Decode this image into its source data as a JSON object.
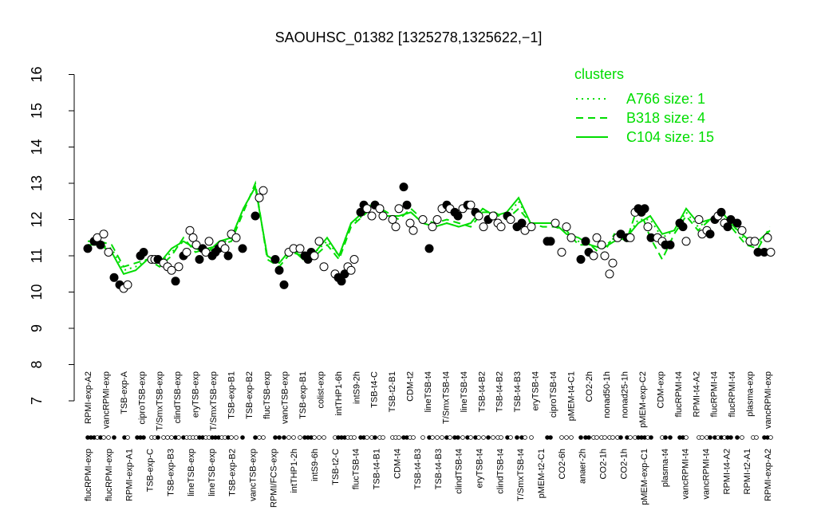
{
  "chart_data": {
    "type": "line",
    "title": "SAOUHSC_01382 [1325278,1325622,−1]",
    "xlabel": "",
    "ylabel": "",
    "ylim": [
      7,
      16
    ],
    "yticks": [
      7,
      8,
      9,
      10,
      11,
      12,
      13,
      14,
      15,
      16
    ],
    "grid": false,
    "legend": {
      "title": "clusters",
      "position": "top-right",
      "color": "#00dd00",
      "entries": [
        {
          "label": "A766 size: 1",
          "style": "dotted"
        },
        {
          "label": "B318 size: 4",
          "style": "dashed"
        },
        {
          "label": "C104 size: 15",
          "style": "solid"
        }
      ]
    },
    "conditions_top": [
      "RPMI-exp-A2",
      "vancRPMI-exp",
      "TSB-exp-A",
      "ciproTSB-exp",
      "T/SmxTSB-exp",
      "clindTSB-exp",
      "eryTSB-exp",
      "T/SmxTSB-exp",
      "TSB-exp-B1",
      "TSB-exp-B2",
      "flucTSB-exp",
      "vancTSB-exp",
      "TSB-exp-B1",
      "colist-exp",
      "intTHP1-6h",
      "intS9-2h",
      "TSB-t4-C",
      "TSB-t2-B1",
      "CDM-t2",
      "lineTSB-t4",
      "T/SmxTSB-t4",
      "lineTSB-t4",
      "TSB-t4-B2",
      "TSB-t4-B2",
      "TSB-t4-B3",
      "eryTSB-t4",
      "ciproTSB-t4",
      "pMEM-t4-C1",
      "CO2-2h",
      "nonad50-1h",
      "nonad25-1h",
      "pMEM-exp-C2",
      "CDM-exp",
      "flucRPMI-t4",
      "RPMI-t4-A2",
      "flucRPMI-t4",
      "flucRPMI-t4",
      "plasma-exp",
      "vancRPMI-exp"
    ],
    "conditions_bottom": [
      "flucRPMI-exp",
      "flucRPMI-exp",
      "RPMI-exp-A1",
      "TSB-exp-C",
      "TSB-exp-B3",
      "lineTSB-exp",
      "lineTSB-exp",
      "TSB-exp-B2",
      "vancTSB-exp",
      "RPMI/FCS-exp",
      "intTHP1-2h",
      "intS9-6h",
      "TSB-t2-C",
      "flucTSB-t4",
      "TSB-t4-B1",
      "CDM-t4",
      "TSB-t4-B3",
      "TSB-t4-B3",
      "clindTSB-t4",
      "eryTSB-t4",
      "clindTSB-t4",
      "T/SmxTSB-t4",
      "pMEM-t2-C1",
      "CO2-6h",
      "anaer-2h",
      "CO2-1h",
      "CO2-1h",
      "pMEM-exp-C1",
      "plasma-t4",
      "vancRPMI-t4",
      "vancRPMI-t4",
      "RPMI-t4-A2",
      "RPMI-t2-A1",
      "RPMI-exp-A2"
    ],
    "series": [
      {
        "style": "solid",
        "x": [
          110,
          125,
          140,
          155,
          170,
          185,
          200,
          215,
          230,
          245,
          260,
          275,
          290,
          305,
          320,
          335,
          350,
          365,
          380,
          395,
          410,
          425,
          440,
          455,
          470,
          485,
          500,
          515,
          530,
          545,
          560,
          575,
          590,
          605,
          620,
          635,
          650,
          665,
          680,
          695,
          710,
          725,
          740,
          755,
          770,
          785,
          800,
          815,
          830,
          845,
          860,
          875,
          890,
          905,
          920,
          935,
          950,
          965
        ],
        "values": [
          11.3,
          11.3,
          11.1,
          10.5,
          10.6,
          10.9,
          10.8,
          11.2,
          11.4,
          11.2,
          11.1,
          11.4,
          11.5,
          12.3,
          12.9,
          11.0,
          10.8,
          11.2,
          10.9,
          11.1,
          11.5,
          11.0,
          11.9,
          12.2,
          12.5,
          12.1,
          12.1,
          12.2,
          11.9,
          11.8,
          11.9,
          11.8,
          11.9,
          12.3,
          12.1,
          12.2,
          12.6,
          11.9,
          11.9,
          11.9,
          11.6,
          11.5,
          11.3,
          11.2,
          11.4,
          11.5,
          11.9,
          12.1,
          11.6,
          11.7,
          12.3,
          11.9,
          12.0,
          12.2,
          11.8,
          11.5,
          11.4,
          11.7
        ]
      },
      {
        "style": "dashed",
        "x": [
          110,
          125,
          140,
          155,
          170,
          185,
          200,
          215,
          230,
          245,
          260,
          275,
          290,
          305,
          320,
          335,
          350,
          365,
          380,
          395,
          410,
          425,
          440,
          455,
          470,
          485,
          500,
          515,
          530,
          545,
          560,
          575,
          590,
          605,
          620,
          635,
          650,
          665,
          680,
          695,
          710,
          725,
          740,
          755,
          770,
          785,
          800,
          815,
          830,
          845,
          860,
          875,
          890,
          905,
          920,
          935,
          950,
          965
        ],
        "values": [
          11.4,
          11.4,
          11.3,
          10.7,
          10.8,
          10.9,
          10.7,
          11.0,
          11.5,
          11.1,
          11.2,
          11.3,
          11.4,
          12.2,
          13.0,
          10.9,
          10.7,
          11.1,
          11.0,
          11.0,
          11.3,
          10.9,
          11.8,
          12.1,
          12.4,
          12.2,
          12.0,
          12.3,
          12.0,
          11.9,
          12.0,
          11.9,
          11.8,
          12.2,
          12.2,
          12.0,
          12.3,
          11.9,
          11.8,
          11.8,
          11.7,
          11.3,
          11.3,
          11.0,
          11.6,
          11.4,
          12.4,
          11.5,
          10.9,
          11.6,
          12.1,
          11.7,
          12.0,
          12.1,
          11.7,
          11.3,
          11.2,
          11.8
        ]
      },
      {
        "style": "dotted",
        "x": [
          110,
          125,
          140,
          155,
          170,
          185,
          200,
          215,
          230,
          245,
          260,
          275,
          290,
          305,
          320,
          335,
          350,
          365,
          380,
          395,
          410,
          425,
          440,
          455,
          470,
          485,
          500,
          515,
          530,
          545,
          560,
          575,
          590,
          605,
          620,
          635,
          650,
          665,
          680,
          695,
          710,
          725,
          740,
          755,
          770,
          785,
          800,
          815,
          830,
          845,
          860,
          875,
          890,
          905,
          920,
          935,
          950,
          965
        ],
        "values": [
          11.3,
          11.3,
          11.2,
          10.6,
          10.7,
          10.9,
          10.8,
          11.1,
          11.4,
          11.2,
          11.1,
          11.3,
          11.5,
          12.3,
          12.9,
          11.0,
          10.8,
          11.2,
          11.0,
          11.1,
          11.4,
          11.0,
          11.9,
          12.1,
          12.5,
          12.1,
          12.1,
          12.2,
          11.9,
          11.8,
          11.9,
          11.8,
          11.9,
          12.3,
          12.1,
          12.1,
          12.5,
          11.9,
          11.9,
          11.9,
          11.6,
          11.4,
          11.3,
          11.2,
          11.5,
          11.5,
          12.0,
          12.0,
          11.5,
          11.7,
          12.2,
          11.8,
          12.0,
          12.2,
          11.8,
          11.4,
          11.3,
          11.7
        ]
      }
    ],
    "points": {
      "x": [
        110,
        118,
        122,
        126,
        130,
        136,
        143,
        150,
        155,
        160,
        176,
        180,
        190,
        194,
        198,
        205,
        210,
        215,
        220,
        224,
        230,
        234,
        238,
        242,
        246,
        250,
        254,
        258,
        262,
        266,
        270,
        274,
        278,
        282,
        286,
        290,
        296,
        304,
        320,
        325,
        330,
        345,
        350,
        356,
        362,
        368,
        376,
        382,
        386,
        390,
        394,
        400,
        406,
        420,
        424,
        428,
        432,
        436,
        440,
        444,
        452,
        456,
        460,
        466,
        470,
        476,
        480,
        492,
        496,
        500,
        506,
        510,
        514,
        518,
        530,
        538,
        542,
        548,
        554,
        560,
        564,
        570,
        574,
        580,
        586,
        590,
        596,
        600,
        606,
        612,
        618,
        624,
        628,
        636,
        640,
        648,
        654,
        658,
        666,
        686,
        690,
        696,
        704,
        710,
        716,
        728,
        734,
        738,
        744,
        748,
        754,
        758,
        764,
        768,
        774,
        778,
        786,
        790,
        796,
        800,
        804,
        808,
        812,
        816,
        824,
        830,
        834,
        840,
        852,
        856,
        860,
        876,
        880,
        886,
        890,
        896,
        900,
        904,
        908,
        912,
        916,
        924,
        930,
        940,
        946,
        950,
        958,
        962,
        966
      ],
      "y": [
        11.2,
        11.4,
        11.5,
        11.3,
        11.6,
        11.1,
        10.4,
        10.2,
        10.1,
        10.2,
        11.0,
        11.1,
        10.9,
        10.9,
        10.9,
        10.8,
        10.7,
        10.6,
        10.3,
        10.7,
        11.0,
        11.1,
        11.7,
        11.5,
        11.3,
        10.9,
        11.2,
        11.1,
        11.4,
        11.0,
        11.1,
        11.2,
        11.3,
        11.2,
        11.0,
        11.6,
        11.5,
        11.2,
        12.1,
        12.6,
        12.8,
        10.9,
        10.6,
        10.2,
        11.1,
        11.2,
        11.2,
        11.0,
        10.9,
        11.1,
        11.0,
        11.4,
        10.7,
        10.5,
        10.4,
        10.3,
        10.5,
        10.7,
        10.6,
        10.9,
        12.2,
        12.4,
        12.3,
        12.1,
        12.4,
        12.3,
        12.1,
        12.0,
        11.8,
        12.3,
        12.9,
        12.4,
        11.9,
        11.7,
        12.0,
        11.2,
        11.8,
        12.0,
        12.3,
        12.4,
        12.3,
        12.2,
        12.1,
        12.3,
        12.4,
        12.4,
        12.2,
        12.1,
        11.8,
        12.0,
        12.1,
        11.9,
        11.8,
        12.1,
        12.0,
        11.8,
        11.9,
        11.7,
        11.8,
        11.4,
        11.4,
        11.9,
        11.1,
        11.8,
        11.5,
        10.9,
        11.4,
        11.1,
        11.0,
        11.5,
        11.3,
        11.0,
        10.5,
        10.8,
        11.5,
        11.6,
        11.5,
        11.5,
        12.2,
        12.3,
        12.2,
        12.3,
        11.8,
        11.5,
        11.5,
        11.4,
        11.3,
        11.3,
        11.9,
        11.8,
        11.4,
        12.0,
        11.6,
        11.7,
        11.6,
        12.0,
        12.1,
        12.2,
        11.9,
        11.8,
        12.0,
        11.9,
        11.7,
        11.4,
        11.4,
        11.1,
        11.1,
        11.5,
        11.1
      ],
      "filled": [
        1,
        1,
        0,
        1,
        0,
        0,
        1,
        1,
        0,
        0,
        1,
        1,
        0,
        0,
        1,
        0,
        0,
        0,
        1,
        0,
        1,
        0,
        0,
        0,
        0,
        1,
        1,
        0,
        0,
        1,
        1,
        1,
        0,
        0,
        1,
        0,
        0,
        1,
        1,
        0,
        0,
        1,
        1,
        1,
        0,
        0,
        0,
        1,
        1,
        1,
        0,
        0,
        0,
        0,
        1,
        1,
        1,
        0,
        0,
        0,
        1,
        1,
        0,
        0,
        1,
        0,
        0,
        0,
        0,
        0,
        1,
        1,
        0,
        0,
        0,
        1,
        0,
        0,
        0,
        1,
        0,
        1,
        1,
        0,
        1,
        0,
        1,
        0,
        0,
        1,
        0,
        0,
        0,
        1,
        0,
        1,
        1,
        0,
        0,
        1,
        1,
        0,
        0,
        0,
        0,
        1,
        1,
        1,
        0,
        0,
        0,
        0,
        0,
        0,
        0,
        1,
        1,
        0,
        0,
        1,
        1,
        1,
        0,
        1,
        0,
        0,
        1,
        1,
        1,
        1,
        0,
        0,
        0,
        0,
        1,
        1,
        0,
        1,
        0,
        1,
        1,
        1,
        0,
        0,
        0,
        1,
        1,
        0,
        0
      ]
    },
    "markers": {
      "x": [
        110,
        114,
        118,
        122,
        126,
        130,
        136,
        143,
        156,
        160,
        172,
        176,
        180,
        190,
        194,
        198,
        205,
        210,
        215,
        220,
        224,
        230,
        234,
        238,
        242,
        246,
        250,
        254,
        258,
        262,
        266,
        270,
        274,
        278,
        282,
        286,
        290,
        296,
        304,
        320,
        325,
        330,
        345,
        350,
        356,
        362,
        368,
        376,
        382,
        386,
        390,
        394,
        400,
        406,
        420,
        424,
        428,
        432,
        436,
        440,
        444,
        452,
        456,
        460,
        466,
        470,
        476,
        480,
        492,
        496,
        500,
        506,
        510,
        514,
        518,
        530,
        538,
        542,
        548,
        554,
        560,
        564,
        570,
        574,
        580,
        586,
        590,
        596,
        600,
        606,
        612,
        618,
        624,
        628,
        636,
        640,
        648,
        654,
        658,
        666,
        686,
        690,
        704,
        710,
        716,
        728,
        734,
        738,
        744,
        748,
        754,
        758,
        764,
        768,
        774,
        778,
        786,
        790,
        796,
        800,
        804,
        808,
        812,
        816,
        830,
        834,
        840,
        852,
        856,
        860,
        876,
        880,
        886,
        890,
        896,
        900,
        904,
        908,
        912,
        916,
        924,
        930,
        944,
        948,
        958,
        962,
        966
      ],
      "filled": [
        1,
        1,
        1,
        0,
        1,
        0,
        0,
        1,
        1,
        0,
        1,
        1,
        1,
        0,
        0,
        1,
        0,
        0,
        0,
        1,
        0,
        1,
        0,
        0,
        0,
        0,
        1,
        1,
        0,
        0,
        1,
        1,
        1,
        0,
        0,
        1,
        0,
        0,
        1,
        1,
        0,
        0,
        1,
        1,
        1,
        0,
        0,
        0,
        1,
        1,
        1,
        0,
        0,
        0,
        0,
        1,
        1,
        1,
        0,
        0,
        0,
        1,
        1,
        0,
        0,
        1,
        0,
        0,
        0,
        0,
        0,
        1,
        1,
        0,
        0,
        0,
        1,
        0,
        0,
        0,
        1,
        0,
        1,
        1,
        0,
        1,
        0,
        1,
        0,
        0,
        1,
        0,
        0,
        0,
        1,
        0,
        1,
        1,
        0,
        0,
        1,
        1,
        0,
        0,
        0,
        1,
        1,
        1,
        0,
        0,
        0,
        0,
        0,
        0,
        0,
        1,
        1,
        0,
        0,
        1,
        1,
        1,
        0,
        1,
        0,
        1,
        1,
        1,
        1,
        0,
        0,
        0,
        0,
        1,
        1,
        0,
        1,
        0,
        1,
        1,
        1,
        0,
        0,
        0,
        1,
        1,
        0
      ]
    }
  }
}
